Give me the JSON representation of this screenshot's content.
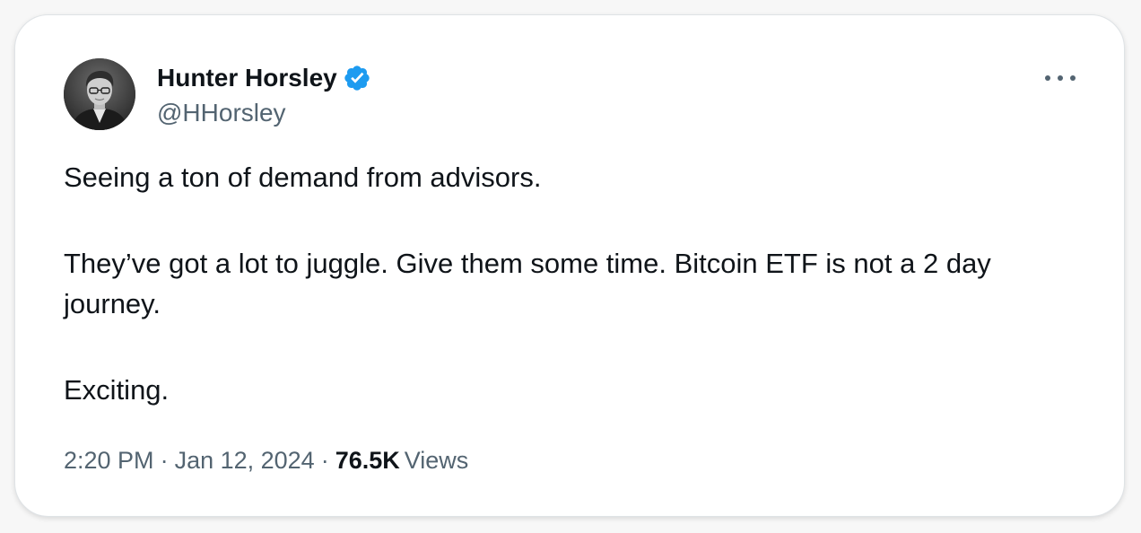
{
  "tweet": {
    "author": {
      "name": "Hunter Horsley",
      "handle": "@HHorsley",
      "verified": true,
      "verified_color": "#1d9bf0"
    },
    "more_icon": "more-horizontal-icon",
    "body": [
      "Seeing a ton of demand from advisors.",
      "They’ve got a lot to juggle. Give them some time. Bitcoin ETF is not a 2 day journey.",
      "Exciting."
    ],
    "time": "2:20 PM",
    "date": "Jan 12, 2024",
    "separator": "·",
    "views_count": "76.5K",
    "views_label": "Views"
  }
}
